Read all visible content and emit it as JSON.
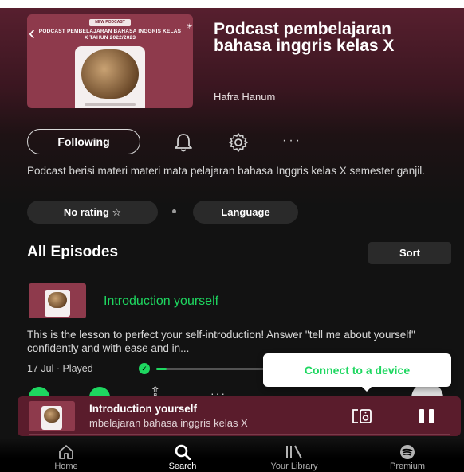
{
  "header": {
    "back_icon": "chevron-left-icon",
    "cover": {
      "tag": "NEW PODCAST",
      "title": "PODCAST PEMBELAJARAN BAHASA INGGRIS KELAS X TAHUN 2022/2023"
    },
    "title": "Podcast pembelajaran bahasa inggris kelas X",
    "author": "Hafra Hanum"
  },
  "actions": {
    "follow_label": "Following",
    "bell_icon": "bell-icon",
    "settings_icon": "gear-icon",
    "more_label": "···"
  },
  "description": "Podcast berisi materi materi mata pelajaran bahasa Inggris kelas X semester ganjil.",
  "chips": {
    "rating": "No rating ☆",
    "language": "Language"
  },
  "episodes_section": {
    "title": "All Episodes",
    "sort_label": "Sort"
  },
  "episode": {
    "title": "Introduction yourself",
    "description": "This is the lesson to perfect your self-introduction! Answer \"tell me about yourself\" confidently and with ease and in...",
    "meta": "17 Jul · Played",
    "progress_fraction": 0.08,
    "share_icon": "share-icon",
    "more_label": "···"
  },
  "tooltip": {
    "text": "Connect to a device"
  },
  "mini_player": {
    "title": "Introduction yourself",
    "subtitle": "mbelajaran bahasa inggris kelas X",
    "device_icon": "connect-device-icon",
    "pause_icon": "pause-icon"
  },
  "nav": {
    "home": "Home",
    "search": "Search",
    "library": "Your Library",
    "premium": "Premium"
  },
  "colors": {
    "accent": "#1ed760",
    "header_tint": "#5a2030",
    "mini_player_bg": "#5a1c2c"
  }
}
